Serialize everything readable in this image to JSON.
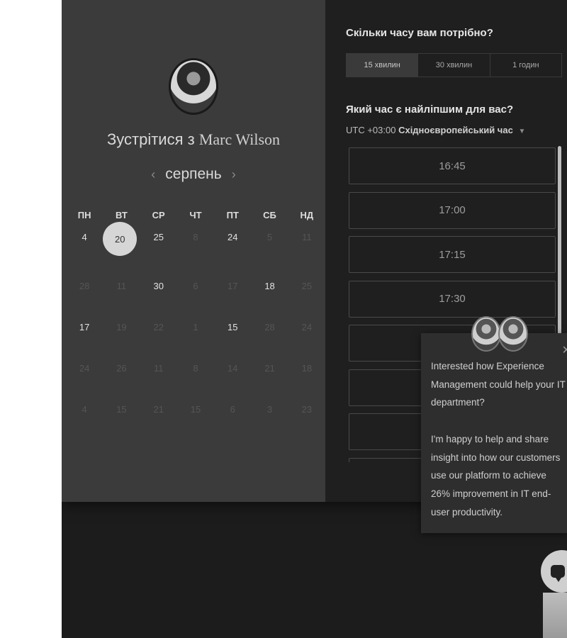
{
  "meeting": {
    "prefix": "Зустрітися з",
    "host_name": "Marc Wilson"
  },
  "calendar": {
    "month": "серпень",
    "prev_icon": "chevron-left-icon",
    "next_icon": "chevron-right-icon",
    "weekdays": [
      "ПН",
      "ВТ",
      "СР",
      "ЧТ",
      "ПТ",
      "СБ",
      "НД"
    ],
    "weeks": [
      [
        "4",
        "20",
        "25",
        "8",
        "24",
        "5",
        "11"
      ],
      [
        "28",
        "11",
        "30",
        "6",
        "17",
        "18",
        "25"
      ],
      [
        "17",
        "19",
        "22",
        "1",
        "15",
        "28",
        "24"
      ],
      [
        "24",
        "26",
        "11",
        "8",
        "14",
        "21",
        "18"
      ],
      [
        "4",
        "15",
        "21",
        "15",
        "6",
        "3",
        "23"
      ]
    ],
    "selected": "20"
  },
  "duration": {
    "question": "Скільки часу вам потрібно?",
    "options": [
      "15 хвилин",
      "30 хвилин",
      "1 годин"
    ],
    "active": "15 хвилин"
  },
  "time": {
    "question": "Який час є найліпшим для вас?",
    "tz_offset": "UTC +03:00",
    "tz_name": "Східноєвропейський час",
    "slots": [
      "16:45",
      "17:00",
      "17:15",
      "17:30",
      "",
      "",
      "",
      ""
    ]
  },
  "chat": {
    "message_1": "Interested how Experience Management could help your IT department?",
    "message_2": "I'm happy to help and share insight into how our customers use our platform to achieve 26% improvement in IT end-user productivity.",
    "close_icon": "close-icon",
    "launcher_icon": "chat-bubble-icon"
  }
}
